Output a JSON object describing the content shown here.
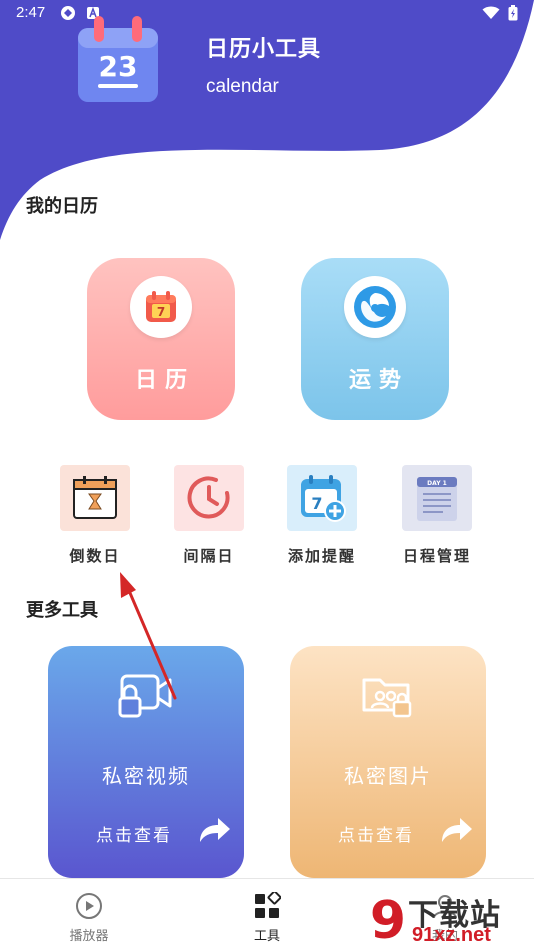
{
  "status_bar": {
    "time": "2:47"
  },
  "header": {
    "title": "日历小工具",
    "subtitle": "calendar",
    "logo_day": "23"
  },
  "my_calendar": {
    "section_title": "我的日历",
    "cards": [
      {
        "label": "日历",
        "icon": "calendar-icon",
        "icon_day": "7"
      },
      {
        "label": "运势",
        "icon": "fortune-icon"
      }
    ],
    "tools": [
      {
        "label": "倒数日",
        "icon": "hourglass-calendar-icon"
      },
      {
        "label": "间隔日",
        "icon": "clock-icon"
      },
      {
        "label": "添加提醒",
        "icon": "add-reminder-icon",
        "icon_day": "7"
      },
      {
        "label": "日程管理",
        "icon": "schedule-icon",
        "icon_text": "DAY 1"
      }
    ]
  },
  "more_tools": {
    "section_title": "更多工具",
    "cards": [
      {
        "title": "私密视频",
        "cta": "点击查看",
        "icon": "private-video-icon"
      },
      {
        "title": "私密图片",
        "cta": "点击查看",
        "icon": "private-image-icon"
      }
    ]
  },
  "bottom_nav": {
    "items": [
      {
        "label": "播放器",
        "icon": "play-icon",
        "active": false
      },
      {
        "label": "工具",
        "icon": "grid-icon",
        "active": true
      },
      {
        "label": "我的",
        "icon": "profile-icon",
        "active": false
      }
    ]
  },
  "watermark": {
    "text": "下载站",
    "url": "91xz.net",
    "logo_mark": "9"
  },
  "colors": {
    "header_purple": "#4f4bc8",
    "calendar_card": "#ffa8a8",
    "fortune_card": "#8ccff0",
    "video_card_top": "#6aa8ea",
    "video_card_bottom": "#5a56cf",
    "image_card_top": "#fde1c0",
    "image_card_bottom": "#eeb674",
    "annotation_arrow": "#d42727"
  }
}
